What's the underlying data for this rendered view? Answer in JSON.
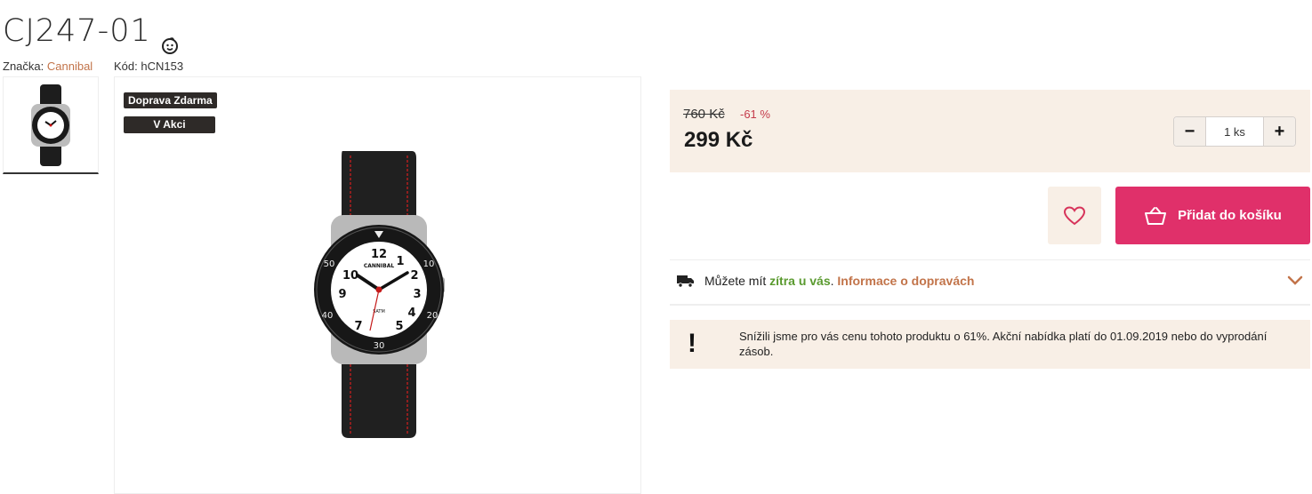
{
  "product": {
    "title": "CJ247-01",
    "brand_label": "Značka:",
    "brand_name": "Cannibal",
    "code_label": "Kód:",
    "code_value": "hCN153"
  },
  "badges": [
    "Doprava Zdarma",
    "V Akci"
  ],
  "watch_dial": {
    "brand": "CANNIBAL",
    "water_resistance": "5ATM",
    "bezel": [
      "10",
      "20",
      "30",
      "40",
      "50"
    ],
    "hours": [
      "12",
      "1",
      "2",
      "3",
      "4",
      "5",
      "7",
      "9",
      "10"
    ]
  },
  "pricing": {
    "old_price": "760 Kč",
    "discount": "-61 %",
    "price": "299 Kč",
    "quantity": "1 ks",
    "minus": "−",
    "plus": "+"
  },
  "actions": {
    "add_to_cart": "Přidat do košíku"
  },
  "delivery": {
    "prefix": "Můžete mít",
    "highlight": "zítra u vás",
    "separator": ".",
    "link": "Informace o dopravách"
  },
  "notice": {
    "mark": "!",
    "text": "Snížili jsme pro vás cenu tohoto produktu o 61%. Akční nabídka platí do 01.09.2019 nebo do vyprodání zásob."
  },
  "colors": {
    "accent": "#e0306a",
    "brand_link": "#c2744a",
    "discount": "#c43a4a",
    "panel_bg": "#f8efe6",
    "green": "#5a9a2f"
  },
  "icons": [
    "baby-icon",
    "heart-icon",
    "basket-icon",
    "truck-icon",
    "chevron-down-icon"
  ]
}
